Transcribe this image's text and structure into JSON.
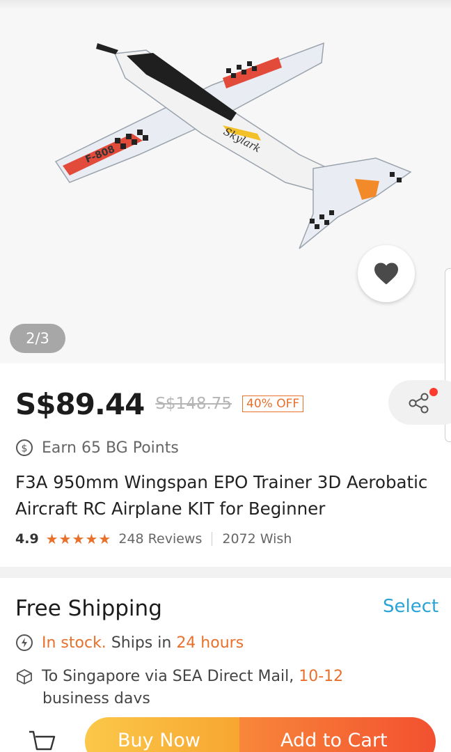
{
  "gallery": {
    "counter": "2/3",
    "plane_markings": [
      "Skylark",
      "F-808"
    ]
  },
  "price": {
    "current": "S$89.44",
    "original": "S$148.75",
    "discount": "40% OFF"
  },
  "points": {
    "text": "Earn 65 BG Points"
  },
  "product": {
    "title": "F3A 950mm Wingspan EPO Trainer 3D Aerobatic Aircraft RC Airplane KIT for Beginner"
  },
  "rating": {
    "score": "4.9",
    "stars": 5,
    "reviews": "248 Reviews",
    "wish": "2072 Wish"
  },
  "shipping": {
    "title": "Free Shipping",
    "select_label": "Select",
    "stock_label": "In stock.",
    "ships_in_prefix": "Ships in",
    "ships_in_value": "24 hours",
    "delivery_prefix": "To Singapore via SEA Direct Mail,",
    "delivery_days": "10-12",
    "delivery_suffix": "business days"
  },
  "actions": {
    "buy_now": "Buy Now",
    "add_to_cart": "Add to Cart"
  },
  "colors": {
    "accent_orange": "#e8702a",
    "link_blue": "#2aa3d6",
    "buy_gradient": "#fbc84a",
    "cart_gradient": "#f2502f"
  }
}
